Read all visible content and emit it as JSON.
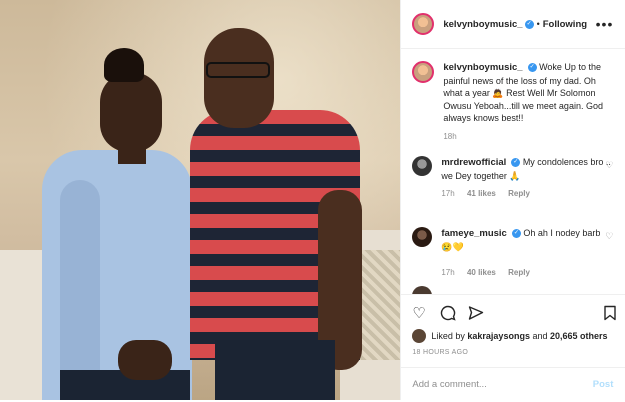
{
  "header": {
    "username": "kelvynboymusic_",
    "following_label": "Following",
    "more_icon": "more-horizontal-icon"
  },
  "caption": {
    "username": "kelvynboymusic_",
    "text": "Woke Up to the painful news of the loss of my dad. Oh what a year 🙇 Rest Well Mr Solomon Owusu Yeboah...till we meet again. God always knows best!!",
    "time": "18h"
  },
  "comments": [
    {
      "username": "mrdrewofficial",
      "text": "My condolences bro .. we Dey together 🙏",
      "time": "17h",
      "likes": "41 likes",
      "reply": "Reply"
    },
    {
      "username": "fameye_music",
      "text": "Oh ah I nodey barb 😢💛",
      "time": "17h",
      "likes": "40 likes",
      "reply": "Reply"
    }
  ],
  "likes": {
    "prefix": "Liked by",
    "user": "kakrajaysongs",
    "middle": "and",
    "count": "20,665 others"
  },
  "timestamp": "18 HOURS AGO",
  "add_comment": {
    "placeholder": "Add a comment...",
    "post_label": "Post"
  },
  "colors": {
    "verified": "#3897f0",
    "post_disabled": "#b2dffc",
    "story_ring": "#e1306c"
  }
}
